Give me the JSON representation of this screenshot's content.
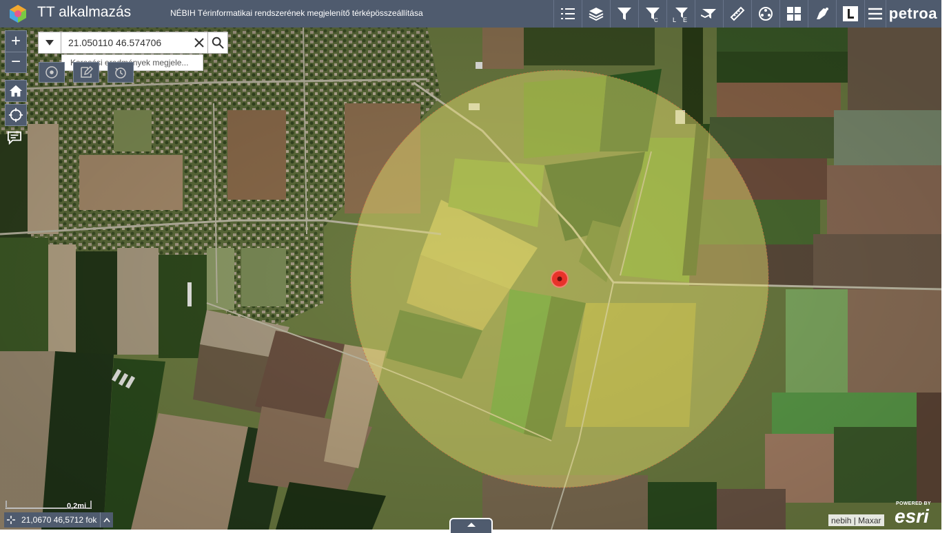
{
  "header": {
    "app_title": "TT alkalmazás",
    "subtitle": "NÉBIH Térinformatikai rendszerének megjelenítő térképösszeállítása",
    "brand": "petroa",
    "tools": [
      "legend-icon",
      "layers-icon",
      "filter-icon",
      "filter-c-icon",
      "filter-le-icon",
      "layer-filter-icon",
      "measure-icon",
      "print-icon",
      "basemap-gallery-icon",
      "draw-icon",
      "logo-l-icon",
      "menu-icon"
    ]
  },
  "search": {
    "value": "21.050110 46.574706",
    "hint": "Keresési eredmények megjele..."
  },
  "map": {
    "scale_label": "0,2mi",
    "coordinates": "21,0670 46,5712 fok",
    "attribution": "nebih | Maxar",
    "esri_powered": "POWERED BY",
    "esri_word": "esri"
  },
  "colors": {
    "header_bg": "#4f5b6e",
    "buffer_fill": "#e8e070",
    "marker": "#e8322a"
  }
}
